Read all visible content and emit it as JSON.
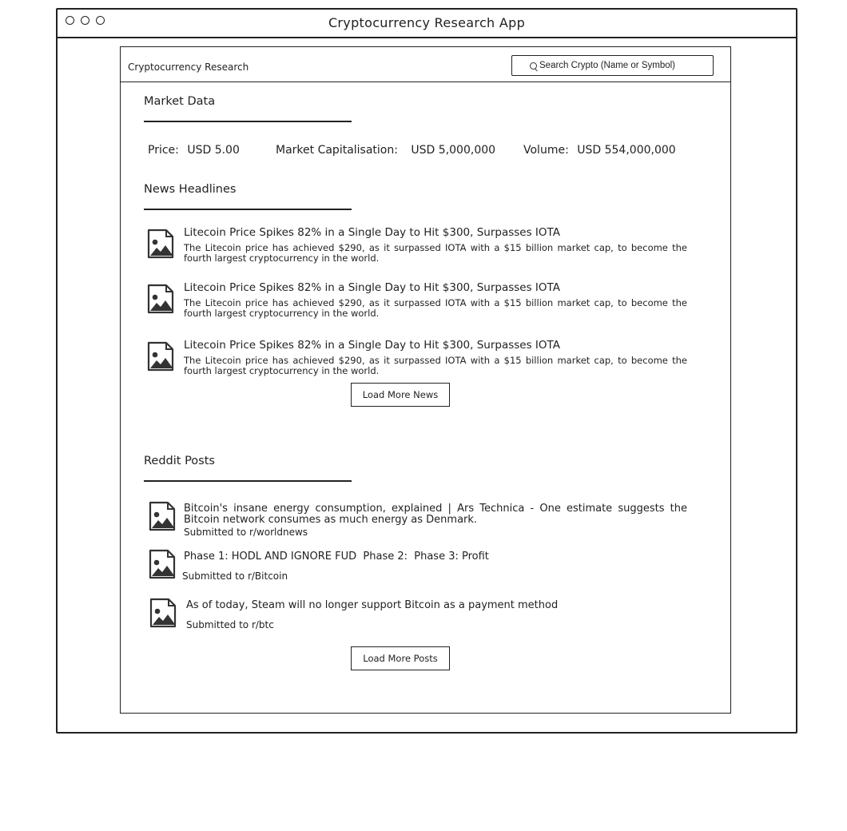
{
  "window": {
    "title": "Cryptocurrency Research App"
  },
  "header": {
    "app_title": "Cryptocurrency Research",
    "search_placeholder": "Search Crypto (Name or Symbol)"
  },
  "market": {
    "section_title": "Market Data",
    "price_label": "Price:",
    "price_value": "USD 5.00",
    "market_cap_label": "Market Capitalisation:",
    "market_cap_value": "USD 5,000,000",
    "volume_label": "Volume:",
    "volume_value": "USD 554,000,000"
  },
  "news": {
    "section_title": "News Headlines",
    "items": [
      {
        "headline": "Litecoin Price Spikes 82% in a Single Day to Hit $300, Surpasses IOTA",
        "summary": "The Litecoin price has achieved $290, as it surpassed IOTA with a $15 billion market cap, to become the fourth largest cryptocurrency in the world."
      },
      {
        "headline": "Litecoin Price Spikes 82% in a Single Day to Hit $300, Surpasses IOTA",
        "summary": "The Litecoin price has achieved $290, as it surpassed IOTA with a $15 billion market cap, to become the fourth largest cryptocurrency in the world."
      },
      {
        "headline": "Litecoin Price Spikes 82% in a Single Day to Hit $300, Surpasses IOTA",
        "summary": "The Litecoin price has achieved $290, as it surpassed IOTA with a $15 billion market cap, to become the fourth largest cryptocurrency in the world."
      }
    ],
    "load_more_label": "Load More News"
  },
  "reddit": {
    "section_title": "Reddit Posts",
    "items": [
      {
        "title": "Bitcoin's insane energy consumption, explained | Ars Technica - One estimate suggests the Bitcoin network consumes as much energy as Denmark.",
        "submitted": "Submitted to r/worldnews"
      },
      {
        "title": "Phase 1: HODL AND IGNORE FUD  Phase 2:  Phase 3: Profit",
        "submitted": "Submitted to r/Bitcoin"
      },
      {
        "title": "As of today, Steam will no longer support Bitcoin as a payment method",
        "submitted": "Submitted to r/btc"
      }
    ],
    "load_more_label": "Load More Posts"
  },
  "icons": {
    "window_controls": [
      "circle-icon",
      "circle-icon",
      "circle-icon"
    ],
    "search": "search-icon",
    "thumbnail": "image-placeholder-icon"
  }
}
